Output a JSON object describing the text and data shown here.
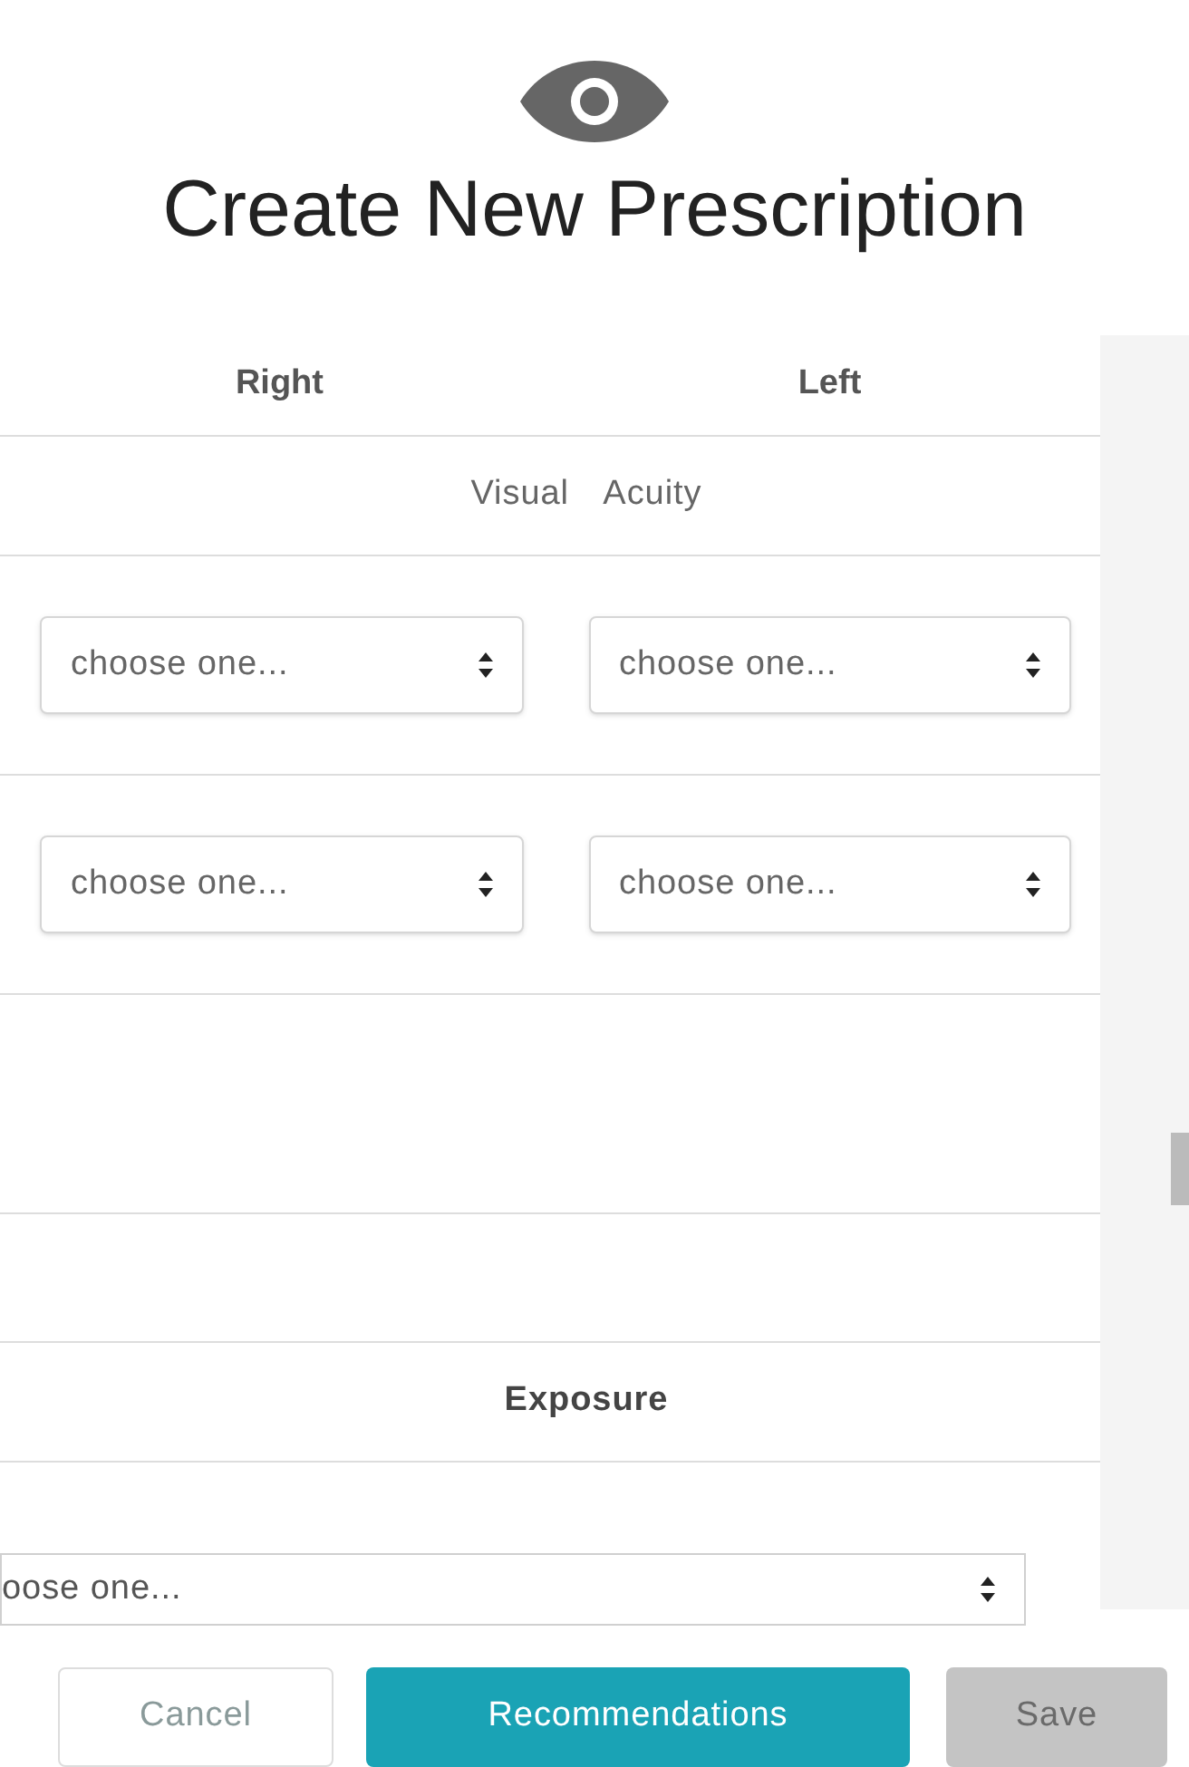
{
  "dialog": {
    "title": "Create New Prescription"
  },
  "columns": [
    "Right",
    "Left"
  ],
  "sections": [
    {
      "kind": "heading",
      "label": "Visual Acuity",
      "bold": false
    },
    {
      "kind": "selects",
      "selects": [
        {
          "placeholder": "choose one..."
        },
        {
          "placeholder": "choose one..."
        }
      ]
    },
    {
      "kind": "selects",
      "selects": [
        {
          "placeholder": "choose one..."
        },
        {
          "placeholder": "choose one..."
        }
      ]
    },
    {
      "kind": "blank"
    },
    {
      "kind": "blank_short"
    },
    {
      "kind": "heading",
      "label": "Exposure",
      "bold": true
    },
    {
      "kind": "wide_select",
      "placeholder": "oose one..."
    }
  ],
  "buttons": [
    {
      "label": "Cancel",
      "kind": "outline",
      "disabled": false
    },
    {
      "label": "Recommendations",
      "kind": "primary",
      "disabled": false
    },
    {
      "label": "Save",
      "kind": "primary",
      "disabled": true
    }
  ]
}
